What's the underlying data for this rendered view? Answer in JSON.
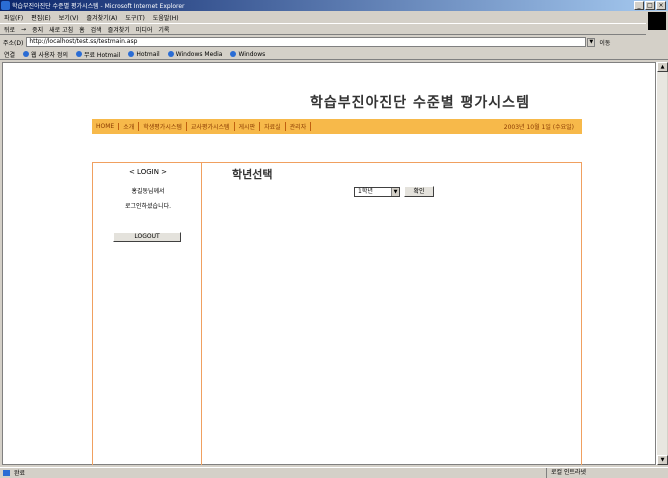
{
  "window": {
    "title": "학습부진아진단 수준별 평가시스템 - Microsoft Internet Explorer",
    "controls": [
      "_",
      "□",
      "×"
    ]
  },
  "menu": [
    "파일(F)",
    "편집(E)",
    "보기(V)",
    "즐겨찾기(A)",
    "도구(T)",
    "도움말(H)"
  ],
  "toolbar": [
    "뒤로",
    "→",
    "중지",
    "새로 고침",
    "홈",
    "검색",
    "즐겨찾기",
    "미디어",
    "기록"
  ],
  "address": {
    "label": "주소(D)",
    "url": "http://localhost/test.ss/testmain.asp",
    "go": "이동"
  },
  "links": {
    "label": "연결",
    "items": [
      "웹 사용자 정의",
      "무료 Hotmail",
      "Hotmail",
      "Windows Media",
      "Windows"
    ]
  },
  "page": {
    "site_title": "학습부진아진단 수준별 평가시스템",
    "nav": [
      "HOME",
      "소개",
      "학생평가시스템",
      "교사평가시스템",
      "게시판",
      "자료실",
      "관리자"
    ],
    "date": "2003년 10월 1일 (수요일)",
    "login": {
      "title": "< LOGIN >",
      "line1": "홍길동님께서",
      "line2": "로그인하셨습니다.",
      "logout": "LOGOUT"
    },
    "section_title": "학년선택",
    "grade_select": "1학년",
    "confirm": "확인"
  },
  "status": {
    "text": "완료",
    "zone": "로컬 인트라넷"
  }
}
